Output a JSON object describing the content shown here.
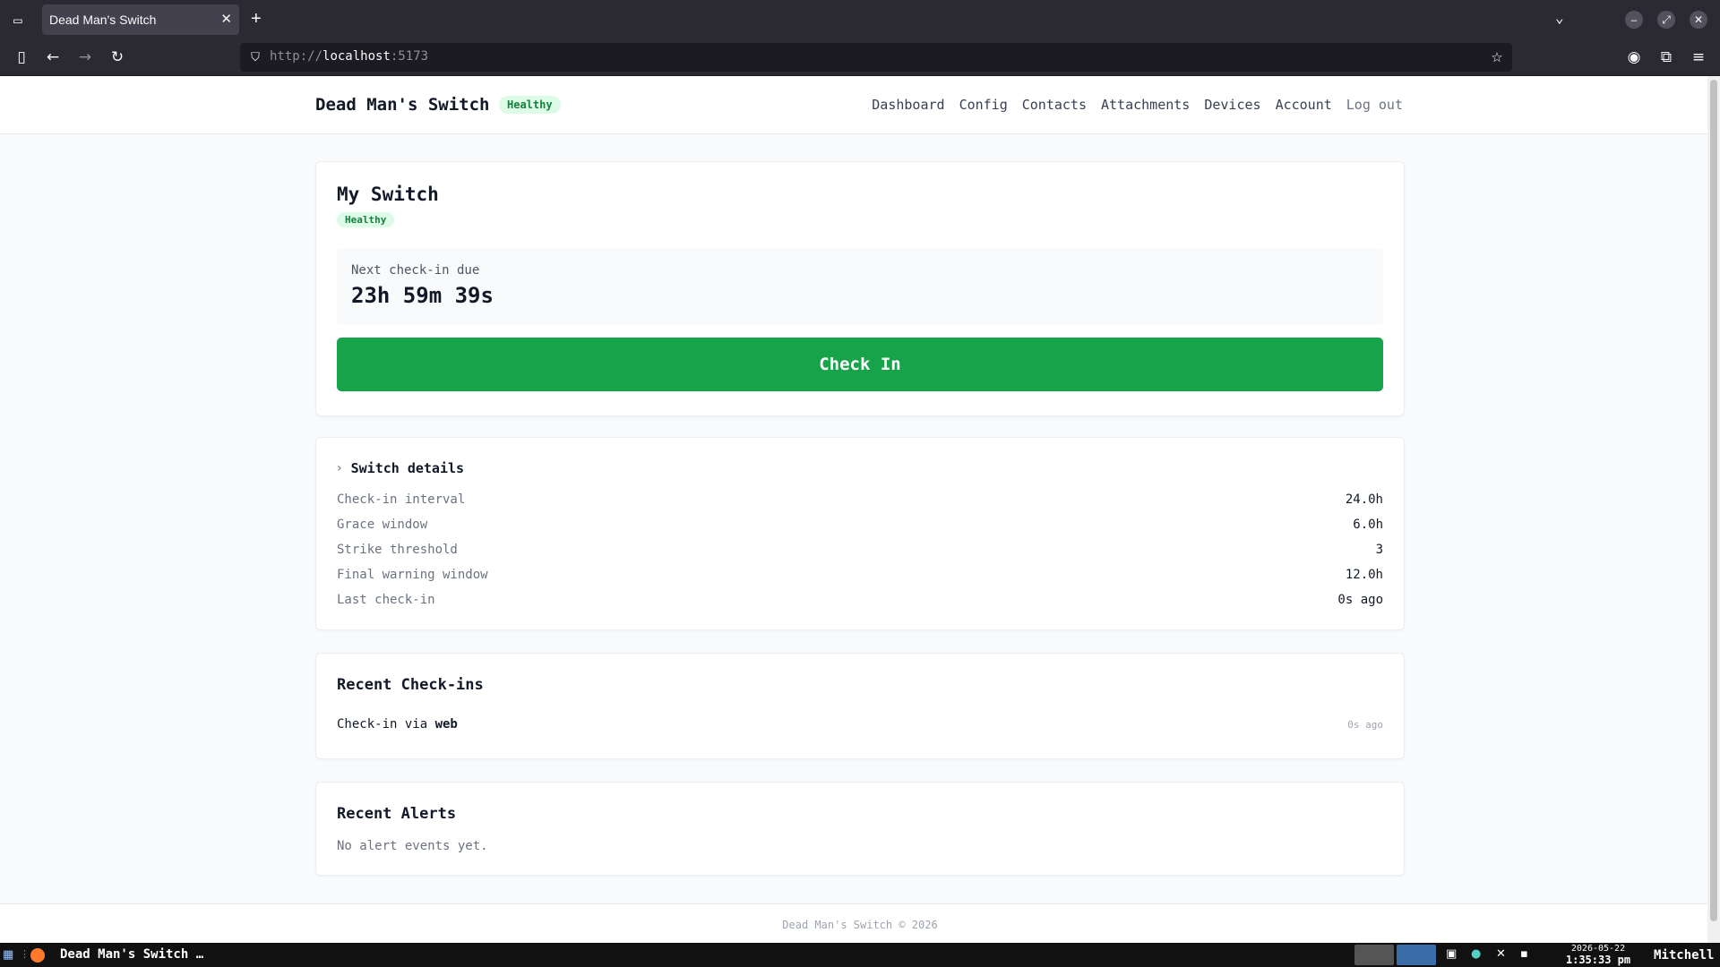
{
  "browser": {
    "tab_title": "Dead Man's Switch",
    "tab_close": "✕",
    "new_tab": "+",
    "url_scheme": "http://",
    "url_host": "localhost",
    "url_port": ":5173"
  },
  "header": {
    "brand": "Dead Man's Switch",
    "status_badge": "Healthy",
    "nav": [
      "Dashboard",
      "Config",
      "Contacts",
      "Attachments",
      "Devices",
      "Account"
    ],
    "logout": "Log out"
  },
  "switch_card": {
    "title": "My Switch",
    "status_badge": "Healthy",
    "countdown_label": "Next check-in due",
    "countdown_value": "23h 59m 39s",
    "checkin_button": "Check In"
  },
  "details": {
    "summary": "Switch details",
    "rows": [
      {
        "label": "Check-in interval",
        "value": "24.0h"
      },
      {
        "label": "Grace window",
        "value": "6.0h"
      },
      {
        "label": "Strike threshold",
        "value": "3"
      },
      {
        "label": "Final warning window",
        "value": "12.0h"
      },
      {
        "label": "Last check-in",
        "value": "0s ago"
      }
    ]
  },
  "recent_checkins": {
    "title": "Recent Check-ins",
    "items": [
      {
        "prefix": "Check-in via ",
        "method": "web",
        "time": "0s ago"
      }
    ]
  },
  "recent_alerts": {
    "title": "Recent Alerts",
    "empty": "No alert events yet."
  },
  "footer": {
    "text": "Dead Man's Switch © 2026"
  },
  "taskbar": {
    "window_title": "Dead Man's Switch …",
    "date": "2026-05-22",
    "time": "1:35:33 pm",
    "user": "Mitchell"
  },
  "colors": {
    "accent_green": "#16a34a",
    "badge_bg": "#dcfce7",
    "badge_fg": "#15803d"
  },
  "icons": {
    "tab_list": "tab-list-icon",
    "back": "arrow-left-icon",
    "forward": "arrow-right-icon",
    "reload": "reload-icon",
    "sidebar": "sidebar-icon",
    "shield": "shield-icon",
    "bookmark": "star-icon",
    "account": "account-icon",
    "extensions": "puzzle-icon",
    "menu": "hamburger-menu-icon",
    "details_toggle": "chevron-right-icon"
  }
}
